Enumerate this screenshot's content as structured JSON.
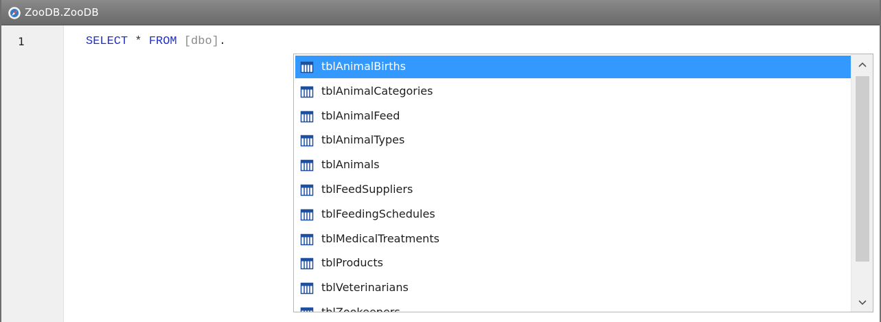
{
  "window": {
    "title": "ZooDB.ZooDB",
    "title_icon": "compass-icon"
  },
  "editor": {
    "line_number": "1",
    "code": {
      "keyword_select": "SELECT",
      "star": "*",
      "keyword_from": "FROM",
      "schema": "[dbo]",
      "dot": "."
    }
  },
  "autocomplete": {
    "item_icon": "table-icon",
    "selected_index": 0,
    "items": [
      "tblAnimalBirths",
      "tblAnimalCategories",
      "tblAnimalFeed",
      "tblAnimalTypes",
      "tblAnimals",
      "tblFeedSuppliers",
      "tblFeedingSchedules",
      "tblMedicalTreatments",
      "tblProducts",
      "tblVeterinarians",
      "tblZookeepers"
    ],
    "scroll_up_glyph": "^",
    "scroll_down_glyph": "v"
  },
  "colors": {
    "selection": "#3399ff",
    "keyword": "#1f2fd6",
    "identifier": "#8a8a8a"
  }
}
